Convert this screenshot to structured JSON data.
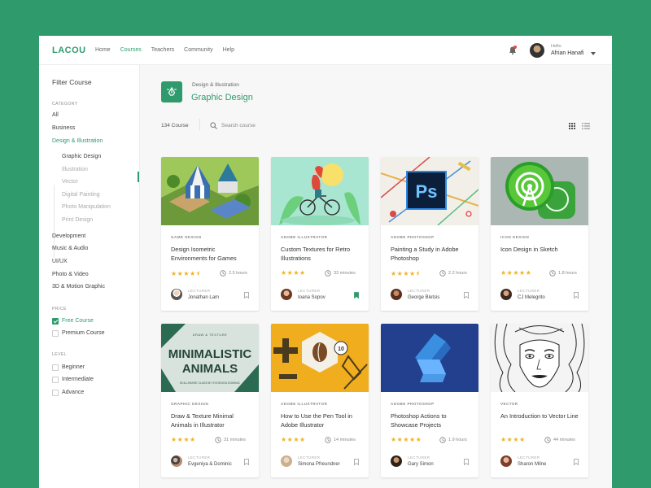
{
  "header": {
    "logo": "LACOU",
    "nav": [
      "Home",
      "Courses",
      "Teachers",
      "Community",
      "Help"
    ],
    "active_nav": "Courses",
    "greeting": "Hello",
    "user_name": "Afrian Hanafi"
  },
  "sidebar": {
    "title": "Filter Course",
    "category_label": "CATEGORY",
    "categories": [
      "All",
      "Business",
      "Design & Illustration"
    ],
    "subcategories": [
      "Graphic Design",
      "Illustration",
      "Vector",
      "Digital Painting",
      "Photo Manipulation",
      "Print Design"
    ],
    "more_categories": [
      "Development",
      "Music & Audio",
      "UI/UX",
      "Photo & Video",
      "3D & Motion Graphic"
    ],
    "price_label": "PRICE",
    "price": [
      "Free Course",
      "Premium Course"
    ],
    "level_label": "LEVEL",
    "levels": [
      "Beginner",
      "Intermediate",
      "Advance"
    ]
  },
  "main": {
    "breadcrumb": "Design & Illustration",
    "title": "Graphic Design",
    "count": "134 Course",
    "search_placeholder": "Search course"
  },
  "lecturer_label": "LECTURER",
  "colors": {
    "accent": "#2f9b6d",
    "star": "#f0b323",
    "bg": "#2f9b6d"
  },
  "courses": [
    {
      "category": "GAME DESIGN",
      "title": "Design Isometric Environments for Games",
      "stars": "★★★★⯨",
      "duration": "2.5 hours",
      "lecturer": "Jonathan Lam",
      "bookmarked": false
    },
    {
      "category": "ADOBE ILLUSTRATOR",
      "title": "Custom Textures for Retro Illustrations",
      "stars": "★★★★",
      "duration": "33 minutes",
      "lecturer": "Ioana Sopov",
      "bookmarked": true
    },
    {
      "category": "ADOBE PHOTOSHOP",
      "title": "Painting a Study in Adobe Photoshop",
      "stars": "★★★★⯨",
      "duration": "2.2 hours",
      "lecturer": "George Bletsis",
      "bookmarked": false
    },
    {
      "category": "ICON DESIGN",
      "title": "Icon Design in Sketch",
      "stars": "★★★★★",
      "duration": "1.8 hours",
      "lecturer": "CJ Melegrito",
      "bookmarked": false
    },
    {
      "category": "GRAPHIC DESIGN",
      "title": "Draw & Texture Minimal Animals in Illustrator",
      "stars": "★★★★",
      "duration": "31 minutes",
      "lecturer": "Evgeniya & Dominic",
      "bookmarked": false
    },
    {
      "category": "ADOBE ILLUSTRATOR",
      "title": "How to Use the Pen Tool in Adobe Illustrator",
      "stars": "★★★★",
      "duration": "14 minutes",
      "lecturer": "Simona Pfreundner",
      "bookmarked": false
    },
    {
      "category": "ADOBE PHOTOSHOP",
      "title": "Photoshop Actions to Showcase Projects",
      "stars": "★★★★★",
      "duration": "1.9 hours",
      "lecturer": "Gary Simon",
      "bookmarked": false
    },
    {
      "category": "VECTOR",
      "title": "An Introduction to Vector Line",
      "stars": "★★★★",
      "duration": "44 minutes",
      "lecturer": "Sharon Milne",
      "bookmarked": false
    }
  ],
  "thumbnails": {
    "ps_label": "Ps",
    "minimal_top": "DRAW & TEXTURE",
    "minimal_title_1": "MINIMALISTIC",
    "minimal_title_2": "ANIMALS",
    "minimal_bottom": "SKILLSHARE CLASS BY EVGENIYA DOMINIC",
    "pen_badge": "10"
  }
}
